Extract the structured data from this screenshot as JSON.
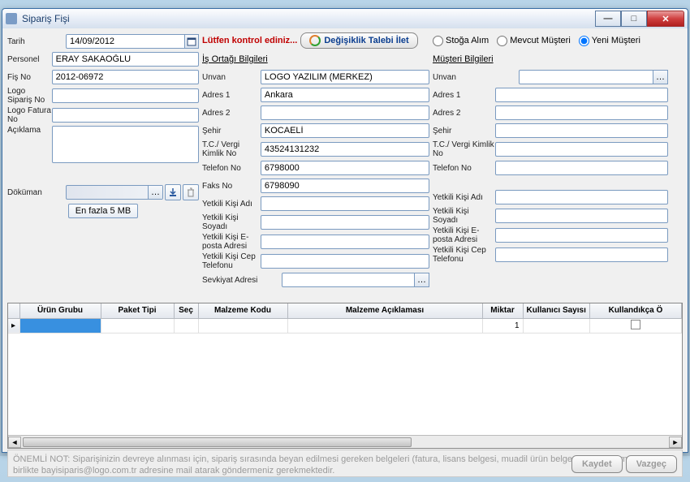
{
  "window": {
    "title": "Sipariş Fişi"
  },
  "left": {
    "tarih_label": "Tarih",
    "tarih": "14/09/2012",
    "personel_label": "Personel",
    "personel": "ERAY SAKAOĞLU",
    "fisno_label": "Fiş No",
    "fisno": "2012-06972",
    "logosiparis_label": "Logo Sipariş No",
    "logosiparis": "",
    "logofatura_label": "Logo Fatura No",
    "logofatura": "",
    "aciklama_label": "Açıklama",
    "aciklama": "",
    "dokuman_label": "Döküman",
    "max_size": "En fazla 5 MB"
  },
  "mid": {
    "warn": "Lütfen kontrol ediniz...",
    "change_btn": "Değişiklik Talebi İlet",
    "tab": "İş Ortağı Bilgileri",
    "unvan_label": "Unvan",
    "unvan": "LOGO YAZILIM (MERKEZ)",
    "adres1_label": "Adres 1",
    "adres1": "Ankara",
    "adres2_label": "Adres 2",
    "adres2": "",
    "sehir_label": "Şehir",
    "sehir": "KOCAELİ",
    "vergi_label": "T.C./ Vergi Kimlik No",
    "vergi": "43524131232",
    "tel_label": "Telefon No",
    "tel": "6798000",
    "faks_label": "Faks No",
    "faks": "6798090",
    "yetkili_ad_label": "Yetkili Kişi Adı",
    "yetkili_ad": "",
    "yetkili_soyad_label": "Yetkili Kişi Soyadı",
    "yetkili_soyad": "",
    "yetkili_eposta_label": "Yetkili Kişi E-posta Adresi",
    "yetkili_eposta": "",
    "yetkili_cep_label": "Yetkili Kişi Cep Telefonu",
    "yetkili_cep": "",
    "sevkiyat_label": "Sevkiyat Adresi",
    "sevkiyat": ""
  },
  "right": {
    "radio_stoga": "Stoğa Alım",
    "radio_mevcut": "Mevcut Müşteri",
    "radio_yeni": "Yeni Müşteri",
    "tab": "Müşteri Bilgileri",
    "unvan_label": "Unvan",
    "unvan": "",
    "adres1_label": "Adres 1",
    "adres1": "",
    "adres2_label": "Adres 2",
    "adres2": "",
    "sehir_label": "Şehir",
    "sehir": "",
    "vergi_label": "T.C./ Vergi Kimlik No",
    "vergi": "",
    "tel_label": "Telefon No",
    "tel": "",
    "yetkili_ad_label": "Yetkili Kişi Adı",
    "yetkili_ad": "",
    "yetkili_soyad_label": "Yetkili Kişi Soyadı",
    "yetkili_soyad": "",
    "yetkili_eposta_label": "Yetkili Kişi E-posta Adresi",
    "yetkili_eposta": "",
    "yetkili_cep_label": "Yetkili Kişi Cep Telefonu",
    "yetkili_cep": ""
  },
  "table": {
    "headers": {
      "urun_grubu": "Ürün Grubu",
      "paket_tipi": "Paket Tipi",
      "sec": "Seç",
      "malzeme_kodu": "Malzeme Kodu",
      "malzeme_acik": "Malzeme Açıklaması",
      "miktar": "Miktar",
      "kullanici": "Kullanıcı Sayısı",
      "kullandikca": "Kullandıkça Ö"
    },
    "row0_miktar": "1"
  },
  "footer": {
    "note": "ÖNEMLİ NOT: Siparişinizin devreye alınması için, sipariş sırasında beyan edilmesi gereken belgeleri (fatura, lisans belgesi, muadil ürün belgesi vb.) fiş numaranız ile birlikte bayisiparis@logo.com.tr adresine mail atarak göndermeniz gerekmektedir.",
    "save": "Kaydet",
    "cancel": "Vazgeç"
  }
}
